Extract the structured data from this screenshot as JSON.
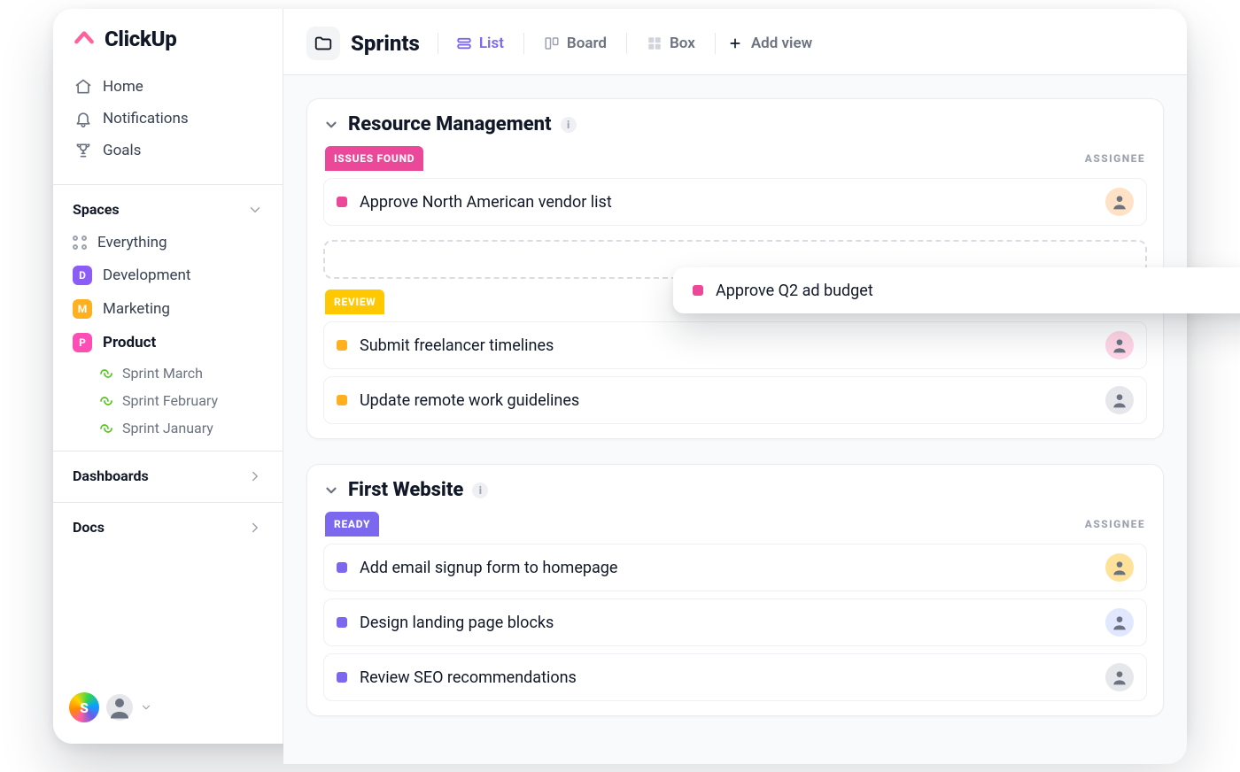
{
  "brand": {
    "name": "ClickUp"
  },
  "sidebar": {
    "nav": {
      "home": "Home",
      "notifications": "Notifications",
      "goals": "Goals"
    },
    "spaces_header": "Spaces",
    "everything": "Everything",
    "spaces": [
      {
        "letter": "D",
        "label": "Development",
        "color": "#8b5cf6"
      },
      {
        "letter": "M",
        "label": "Marketing",
        "color": "#ffb020"
      },
      {
        "letter": "P",
        "label": "Product",
        "color": "#fd4eb5",
        "active": true
      }
    ],
    "product_sprints": [
      {
        "label": "Sprint  March"
      },
      {
        "label": "Sprint  February"
      },
      {
        "label": "Sprint January"
      }
    ],
    "dashboards": "Dashboards",
    "docs": "Docs",
    "user_initial": "S"
  },
  "header": {
    "title": "Sprints",
    "tabs": {
      "list": "List",
      "board": "Board",
      "box": "Box"
    },
    "add_view": "Add view"
  },
  "assignee_label": "ASSIGNEE",
  "groups": {
    "resource": {
      "title": "Resource Management",
      "statuses": {
        "issues_found": {
          "label": "ISSUES FOUND",
          "color": "pink",
          "tasks": [
            {
              "title": "Approve North American vendor list"
            }
          ]
        },
        "dragging": {
          "task_title": "Approve Q2 ad budget"
        },
        "review": {
          "label": "REVIEW",
          "color": "yellow",
          "tasks": [
            {
              "title": "Submit freelancer timelines"
            },
            {
              "title": "Update remote work guidelines"
            }
          ]
        }
      }
    },
    "website": {
      "title": "First Website",
      "statuses": {
        "ready": {
          "label": "READY",
          "color": "violet",
          "tasks": [
            {
              "title": "Add email signup form to homepage"
            },
            {
              "title": "Design landing page blocks"
            },
            {
              "title": "Review SEO recommendations"
            }
          ]
        }
      }
    }
  }
}
